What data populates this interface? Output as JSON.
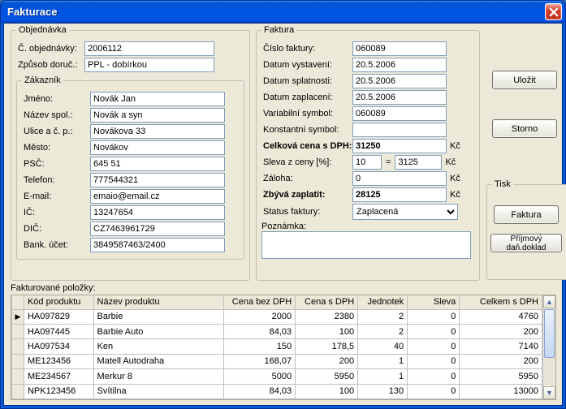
{
  "window": {
    "title": "Fakturace"
  },
  "buttons": {
    "ulozit": "Uložit",
    "storno": "Storno",
    "faktura": "Faktura",
    "prijmovy": "Příjmový daň.doklad"
  },
  "objednavka": {
    "legend": "Objednávka",
    "fields": {
      "c_obj_label": "Č. objednávky:",
      "c_obj": "2006112",
      "zpusob_label": "Způsob doruč.:",
      "zpusob": "PPL - dobírkou"
    },
    "zakaznik": {
      "legend": "Zákazník",
      "jmeno_label": "Jméno:",
      "jmeno": "Novák Jan",
      "nazev_label": "Název spol.:",
      "nazev": "Novák a syn",
      "ulice_label": "Ulice a č. p.:",
      "ulice": "Novákova 33",
      "mesto_label": "Město:",
      "mesto": "Novákov",
      "psc_label": "PSČ:",
      "psc": "645 51",
      "tel_label": "Telefon:",
      "tel": "777544321",
      "email_label": "E-mail:",
      "email": "emaio@email.cz",
      "ic_label": "IČ:",
      "ic": "13247654",
      "dic_label": "DIČ:",
      "dic": "CZ7463961729",
      "bank_label": "Bank. účet:",
      "bank": "3849587463/2400"
    }
  },
  "faktura": {
    "legend": "Faktura",
    "cislo_label": "Číslo faktury:",
    "cislo": "060089",
    "vystaveni_label": "Datum vystavení:",
    "vystaveni": "20.5.2006",
    "splatnost_label": "Datum splatnosti:",
    "splatnost": "20.5.2006",
    "zaplaceni_label": "Datum zaplacení:",
    "zaplaceni": "20.5.2006",
    "varsym_label": "Variabilní symbol:",
    "varsym": "060089",
    "konstsym_label": "Konstantní symbol:",
    "konstsym": "",
    "cena_label": "Celková cena s DPH:",
    "cena": "31250",
    "sleva_label": "Sleva z ceny [%]:",
    "sleva_pct": "10",
    "sleva_eq": "=",
    "sleva_val": "3125",
    "zaloha_label": "Záloha:",
    "zaloha": "0",
    "zbyva_label": "Zbývá zaplatit:",
    "zbyva": "28125",
    "status_label": "Status faktury:",
    "status": "Zaplacená",
    "poznamka_label": "Poznámka:",
    "poznamka": "",
    "kc": "Kč"
  },
  "tisk": {
    "legend": "Tisk"
  },
  "polozky_label": "Fakturované položky:",
  "grid": {
    "columns": [
      "Kód produktu",
      "Název produktu",
      "Cena bez DPH",
      "Cena s DPH",
      "Jednotek",
      "Sleva",
      "Celkem s DPH"
    ],
    "rows": [
      {
        "marker": "▶",
        "cells": [
          "HA097829",
          "Barbie",
          "2000",
          "2380",
          "2",
          "0",
          "4760"
        ]
      },
      {
        "marker": "",
        "cells": [
          "HA097445",
          "Barbie Auto",
          "84,03",
          "100",
          "2",
          "0",
          "200"
        ]
      },
      {
        "marker": "",
        "cells": [
          "HA097534",
          "Ken",
          "150",
          "178,5",
          "40",
          "0",
          "7140"
        ]
      },
      {
        "marker": "",
        "cells": [
          "ME123456",
          "Matell Autodraha",
          "168,07",
          "200",
          "1",
          "0",
          "200"
        ]
      },
      {
        "marker": "",
        "cells": [
          "ME234567",
          "Merkur 8",
          "5000",
          "5950",
          "1",
          "0",
          "5950"
        ]
      },
      {
        "marker": "",
        "cells": [
          "NPK123456",
          "Svítilna",
          "84,03",
          "100",
          "130",
          "0",
          "13000"
        ]
      }
    ]
  }
}
